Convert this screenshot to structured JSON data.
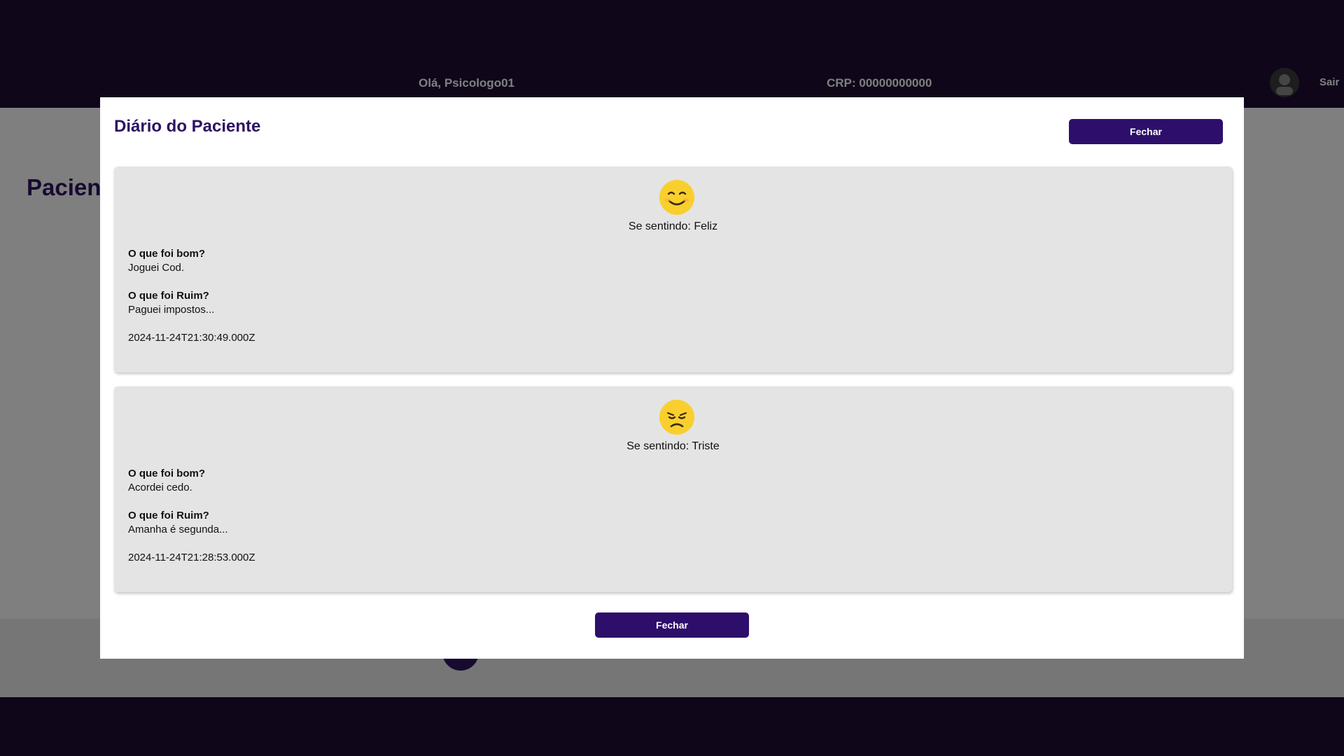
{
  "header": {
    "greeting": "Olá, Psicologo01",
    "crp": "CRP: 00000000000",
    "logout_label": "Sair"
  },
  "page": {
    "title": "Pacientes"
  },
  "modal": {
    "title": "Diário do Paciente",
    "close_top_label": "Fechar",
    "close_bottom_label": "Fechar",
    "good_label": "O que foi bom?",
    "bad_label": "O que foi Ruim?",
    "mood_prefix": "Se sentindo: ",
    "entries": [
      {
        "mood": "Feliz",
        "mood_icon": "smiling-face-icon",
        "good": "Joguei Cod.",
        "bad": "Paguei impostos...",
        "timestamp": "2024-11-24T21:30:49.000Z"
      },
      {
        "mood": "Triste",
        "mood_icon": "sad-face-icon",
        "good": "Acordei cedo.",
        "bad": "Amanha é segunda...",
        "timestamp": "2024-11-24T21:28:53.000Z"
      }
    ]
  },
  "colors": {
    "header_bg": "#1e0d35",
    "accent": "#2d0f6b",
    "card_bg": "#e4e4e4",
    "emoji_yellow": "#f9cf2e"
  }
}
